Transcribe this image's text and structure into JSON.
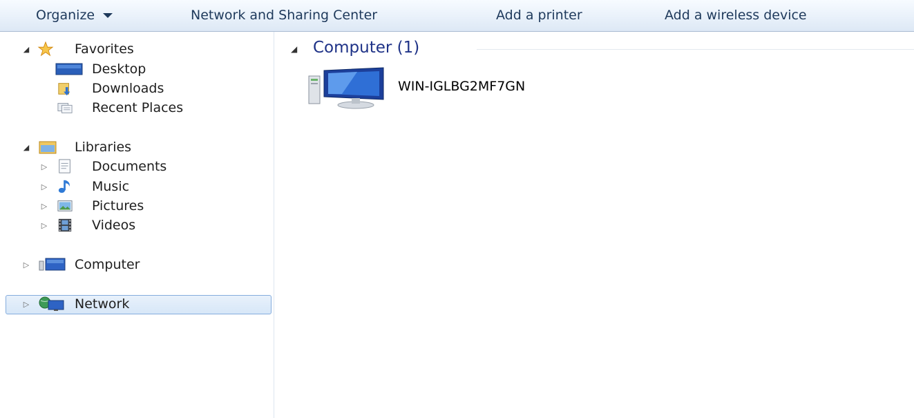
{
  "toolbar": {
    "organize": "Organize",
    "network_sharing": "Network and Sharing Center",
    "add_printer": "Add a printer",
    "add_wireless": "Add a wireless device"
  },
  "nav": {
    "favorites": {
      "label": "Favorites",
      "items": [
        {
          "label": "Desktop",
          "icon": "desktop-icon"
        },
        {
          "label": "Downloads",
          "icon": "downloads-icon"
        },
        {
          "label": "Recent Places",
          "icon": "recent-places-icon"
        }
      ]
    },
    "libraries": {
      "label": "Libraries",
      "items": [
        {
          "label": "Documents",
          "icon": "documents-icon"
        },
        {
          "label": "Music",
          "icon": "music-icon"
        },
        {
          "label": "Pictures",
          "icon": "pictures-icon"
        },
        {
          "label": "Videos",
          "icon": "videos-icon"
        }
      ]
    },
    "computer": {
      "label": "Computer",
      "icon": "computer-icon"
    },
    "network": {
      "label": "Network",
      "icon": "network-icon",
      "selected": true
    }
  },
  "content": {
    "group_title": "Computer (1)",
    "items": [
      {
        "label": "WIN-IGLBG2MF7GN",
        "icon": "computer-icon"
      }
    ]
  },
  "colors": {
    "selection_border": "#84acdd",
    "group_title": "#1e3287",
    "toolbar_text": "#1e395b"
  }
}
